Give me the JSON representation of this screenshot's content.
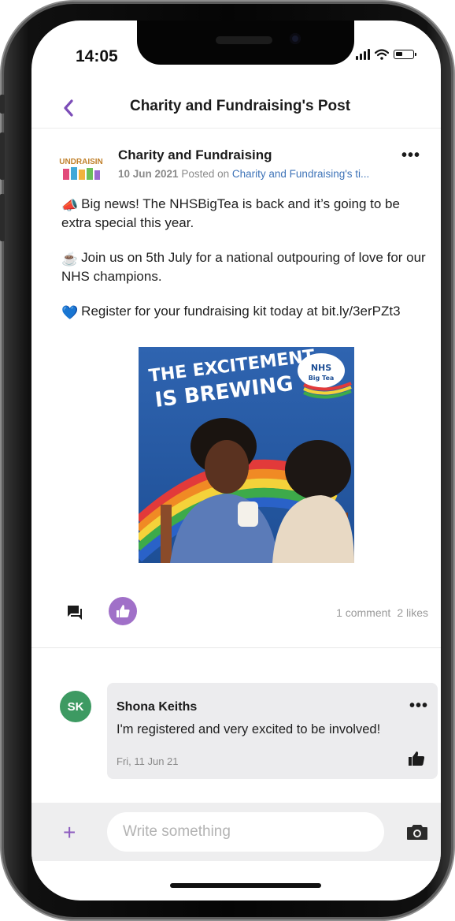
{
  "status_bar": {
    "time": "14:05"
  },
  "header": {
    "title": "Charity and Fundraising's Post"
  },
  "post": {
    "author": "Charity and Fundraising",
    "avatar_text": "UNDRAISIN",
    "date": "10 Jun 2021",
    "posted_on_label": "Posted on",
    "posted_on_link": "Charity and Fundraising's ti...",
    "more": "•••",
    "paragraphs": [
      {
        "emoji": "📣",
        "text": "Big news! The NHSBigTea is back and it’s going to be extra special this year."
      },
      {
        "emoji": "☕",
        "text": "Join us on 5th July for a national outpouring of love for our NHS champions."
      },
      {
        "emoji": "💙",
        "text": "Register for your fundraising kit today at bit.ly/3erPZt3"
      }
    ],
    "image": {
      "line1": "THE EXCITEMENT",
      "line2": "IS BREWING",
      "badge_top": "NHS",
      "badge_bottom": "Big Tea"
    },
    "stats": {
      "comments": "1 comment",
      "likes": "2 likes"
    }
  },
  "comment": {
    "initials": "SK",
    "author": "Shona Keiths",
    "text": "I'm registered and very excited to be involved!",
    "date": "Fri, 11 Jun 21",
    "more": "•••"
  },
  "compose": {
    "add": "+",
    "placeholder": "Write something"
  },
  "colors": {
    "accent": "#a070c8",
    "avatar_green": "#3d9a62",
    "link": "#3f74b8"
  },
  "icons": [
    "back-icon",
    "comment-icon",
    "thumbs-up-icon",
    "plus-icon",
    "camera-icon",
    "more-icon"
  ]
}
